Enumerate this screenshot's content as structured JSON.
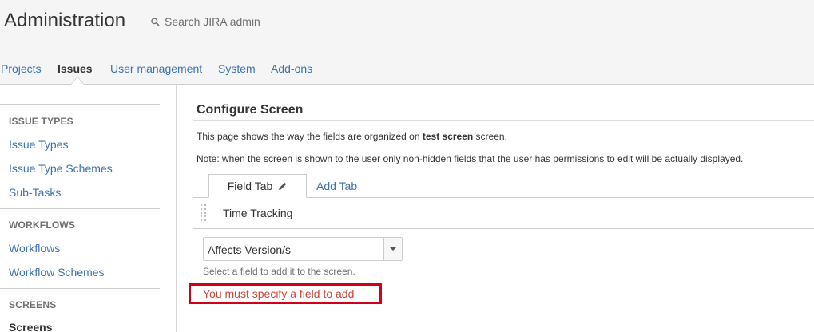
{
  "header": {
    "title": "Administration",
    "search_placeholder": "Search JIRA admin"
  },
  "nav": {
    "items": [
      {
        "label": "Projects"
      },
      {
        "label": "Issues"
      },
      {
        "label": "User management"
      },
      {
        "label": "System"
      },
      {
        "label": "Add-ons"
      }
    ]
  },
  "sidebar": {
    "sections": [
      {
        "heading": "ISSUE TYPES",
        "items": [
          "Issue Types",
          "Issue Type Schemes",
          "Sub-Tasks"
        ]
      },
      {
        "heading": "WORKFLOWS",
        "items": [
          "Workflows",
          "Workflow Schemes"
        ]
      },
      {
        "heading": "SCREENS",
        "items": [
          "Screens"
        ]
      }
    ]
  },
  "main": {
    "title": "Configure Screen",
    "desc_prefix": "This page shows the way the fields are organized on ",
    "desc_screen": "test screen",
    "desc_suffix": " screen.",
    "note": "Note: when the screen is shown to the user only non-hidden fields that the user has permissions to edit will be actually displayed.",
    "tab_active": "Field Tab",
    "tab_add": "Add Tab",
    "field": "Time Tracking",
    "select_value": "Affects Version/s",
    "help": "Select a field to add it to the screen.",
    "error": "You must specify a field to add"
  },
  "colors": {
    "link": "#3b73af",
    "error": "#d04437",
    "error_box": "#d0021b"
  }
}
